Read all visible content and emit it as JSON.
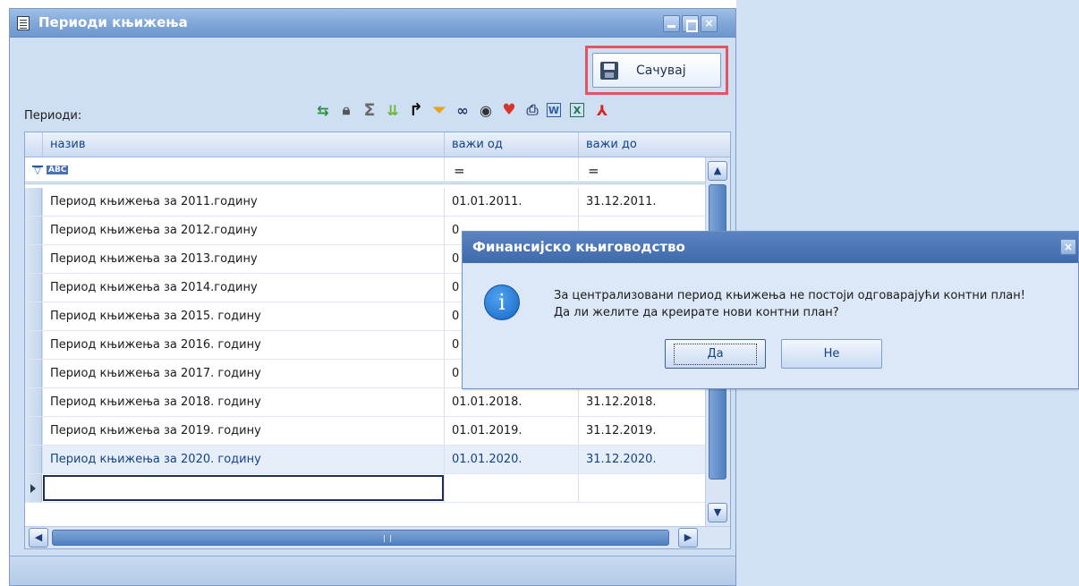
{
  "window": {
    "title": "Периоди књижења",
    "save_label": "Сачувај",
    "periods_label": "Периоди:"
  },
  "toolbar": {
    "icons": [
      "refresh-icon",
      "lock-icon",
      "sum-icon",
      "expand-icon",
      "export-arrow-icon",
      "filter-icon",
      "binoculars-search-icon",
      "eye-icon",
      "heart-color-icon",
      "print-icon",
      "word-icon",
      "excel-icon",
      "pdf-icon"
    ]
  },
  "grid": {
    "columns": [
      "назив",
      "важи од",
      "важи до"
    ],
    "filter": {
      "text_badge": "ABC",
      "op_from": "=",
      "op_to": "="
    },
    "rows": [
      {
        "name": "Период књижења за 2011.годину",
        "from": "01.01.2011.",
        "to": "31.12.2011."
      },
      {
        "name": "Период књижења за 2012.годину",
        "from": "0",
        "to": ""
      },
      {
        "name": "Период књижења за 2013.годину",
        "from": "0",
        "to": ""
      },
      {
        "name": "Период књижења за 2014.годину",
        "from": "0",
        "to": ""
      },
      {
        "name": "Период књижења за 2015. годину",
        "from": "0",
        "to": ""
      },
      {
        "name": "Период књижења за 2016. годину",
        "from": "0",
        "to": ""
      },
      {
        "name": "Период књижења за 2017. годину",
        "from": "0",
        "to": ""
      },
      {
        "name": "Период књижења за 2018. годину",
        "from": "01.01.2018.",
        "to": "31.12.2018."
      },
      {
        "name": "Период књижења за 2019. годину",
        "from": "01.01.2019.",
        "to": "31.12.2019."
      },
      {
        "name": "Период књижења за 2020. годину",
        "from": "01.01.2020.",
        "to": "31.12.2020."
      }
    ]
  },
  "dialog": {
    "title": "Финансијско књиговодство",
    "line1": "За централизовани период књижења не постоји одговарајући контни план!",
    "line2": "Да ли желите да креирате нови контни план?",
    "yes_label": "Да",
    "no_label": "Не"
  }
}
